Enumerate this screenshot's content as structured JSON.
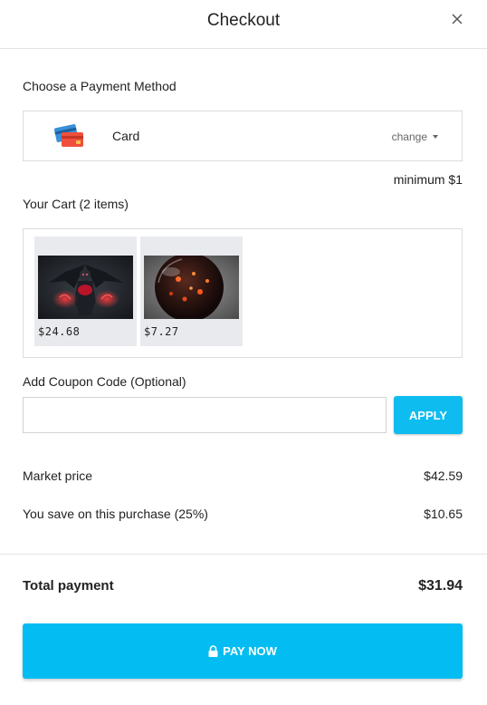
{
  "header": {
    "title": "Checkout",
    "close_icon": "close-icon"
  },
  "payment": {
    "section_label": "Choose a Payment Method",
    "method_label": "Card",
    "method_icon": "credit-card-icon",
    "change_label": "change",
    "minimum_text": "minimum $1"
  },
  "cart": {
    "section_label": "Your Cart (2 items)",
    "items": [
      {
        "price": "$24.68",
        "image": "dark-winged-figure-red-glow"
      },
      {
        "price": "$7.27",
        "image": "glass-sphere-red-embers"
      }
    ]
  },
  "coupon": {
    "section_label": "Add Coupon Code (Optional)",
    "input_value": "",
    "input_placeholder": "",
    "apply_label": "APPLY"
  },
  "summary": {
    "market_price_label": "Market price",
    "market_price_value": "$42.59",
    "savings_label": "You save on this purchase (25%)",
    "savings_value": "$10.65",
    "total_label": "Total payment",
    "total_value": "$31.94"
  },
  "pay_button": {
    "label": "PAY NOW",
    "icon": "lock-icon"
  },
  "colors": {
    "accent": "#03bdf2",
    "apply": "#0ebcf0"
  }
}
